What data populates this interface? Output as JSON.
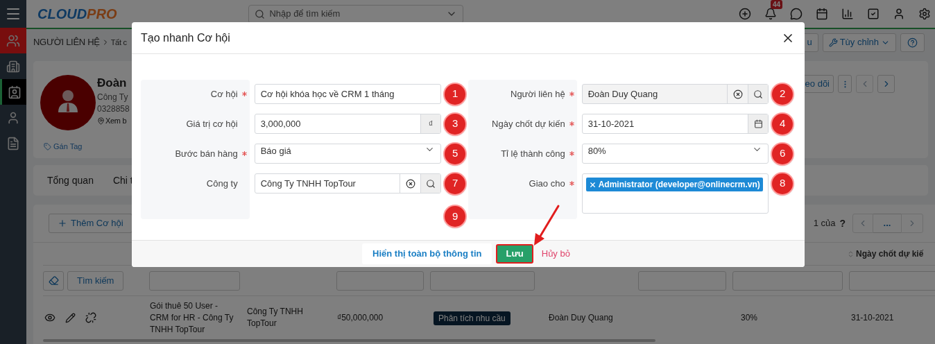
{
  "sidebar": {
    "items": [
      {
        "highlighted": true,
        "selected": false
      },
      {
        "highlighted": false,
        "selected": false
      },
      {
        "highlighted": false,
        "selected": true
      },
      {
        "highlighted": false,
        "selected": false
      },
      {
        "highlighted": false,
        "selected": false
      }
    ]
  },
  "header": {
    "logo": {
      "part1": "CLOUD",
      "part2": "PRO"
    },
    "search": {
      "placeholder": "Nhập để tìm kiếm"
    },
    "notification_count": "44"
  },
  "breadcrumb": {
    "module": "NGƯỜI LIÊN HỆ",
    "current": "Tất c"
  },
  "toolbar": {
    "button_1": "u",
    "customize": "Tùy chỉnh"
  },
  "profile": {
    "name": "Đoàn",
    "company": "Công Ty",
    "phone": "0328858",
    "map_link": "Xem b",
    "tag_link": "Gán Tag",
    "follow_button": "eo dõi"
  },
  "tabs": [
    {
      "label": "Tổng quan"
    },
    {
      "label": "Chi t"
    }
  ],
  "list": {
    "add_button": "Thêm Cơ hội",
    "page_info": "1 của",
    "help": "?",
    "pagination_middle": "...",
    "sort_column": "Ngày chốt dự kiế",
    "search_button": "Tìm kiếm",
    "rows": [
      {
        "column_1": "Gói thuê 50 User - CRM for HR - Công Ty TNHH TopTour",
        "column_2": "Công Ty TNHH TopTour",
        "column_3": "₫50,000,000",
        "column_4": "Phân tích nhu cầu",
        "column_5": "Đoàn Duy Quang",
        "column_7": "30%",
        "column_8": "31-10-2021"
      }
    ]
  },
  "modal": {
    "title": "Tạo nhanh Cơ hội",
    "left_fields": [
      {
        "label": "Cơ hội",
        "required": true,
        "kind": "text",
        "value": "Cơ hội khóa học về CRM 1 tháng",
        "annotation": "1"
      },
      {
        "label": "Giá trị cơ hội",
        "required": false,
        "kind": "currency",
        "value": "3,000,000",
        "unit": "₫",
        "annotation": "3"
      },
      {
        "label": "Bước bán hàng",
        "required": true,
        "kind": "select",
        "value": "Báo giá",
        "annotation": "5"
      },
      {
        "label": "Công ty",
        "required": false,
        "kind": "lookup",
        "readonly": false,
        "value": "Công Ty TNHH TopTour",
        "annotation": "7"
      }
    ],
    "right_fields": [
      {
        "label": "Người liên hệ",
        "required": true,
        "kind": "lookup",
        "readonly": true,
        "value": "Đoàn Duy Quang",
        "annotation": "2"
      },
      {
        "label": "Ngày chốt dự kiến",
        "required": true,
        "kind": "date",
        "value": "31-10-2021",
        "annotation": "4"
      },
      {
        "label": "Tỉ lệ thành công",
        "required": true,
        "kind": "select",
        "value": "80%",
        "annotation": "6"
      },
      {
        "label": "Giao cho",
        "required": true,
        "kind": "tags",
        "tags": [
          "Administrator (developer@onlinecrm.vn)"
        ],
        "annotation": "8"
      }
    ],
    "footer_annotation": "9",
    "buttons": [
      {
        "label": "Hiển thị toàn bộ thông tin",
        "kind": "secondary",
        "highlighted": false
      },
      {
        "label": "Lưu",
        "kind": "primary",
        "highlighted": true
      },
      {
        "label": "Hủy bỏ",
        "kind": "link",
        "highlighted": false
      }
    ]
  }
}
